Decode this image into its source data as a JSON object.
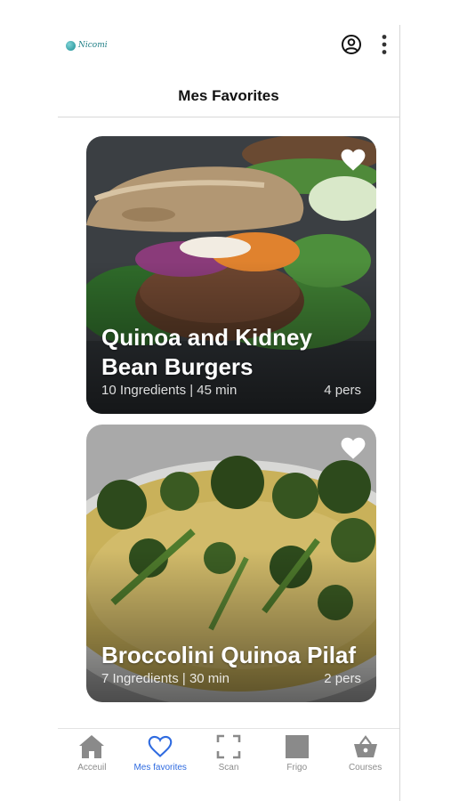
{
  "header": {
    "logo_text": "Nicomi",
    "page_title": "Mes Favorites",
    "profile_icon": "account-circle-icon",
    "menu_icon": "more-vertical-icon"
  },
  "recipes": [
    {
      "title": "Quinoa and Kidney Bean Burgers",
      "ingredients": "10 Ingredients | 45 min",
      "servings": "4 pers",
      "favorite": true
    },
    {
      "title": "Broccolini Quinoa Pilaf",
      "ingredients": "7 Ingredients | 30 min",
      "servings": "2 pers",
      "favorite": true
    }
  ],
  "nav": {
    "active_color": "#2f6be0",
    "inactive_color": "#8c8c8c",
    "items": [
      {
        "label": "Acceuil",
        "icon": "home-icon",
        "active": false
      },
      {
        "label": "Mes favorites",
        "icon": "heart-icon",
        "active": true
      },
      {
        "label": "Scan",
        "icon": "scan-icon",
        "active": false
      },
      {
        "label": "Frigo",
        "icon": "fridge-icon",
        "active": false
      },
      {
        "label": "Courses",
        "icon": "shopping-basket-icon",
        "active": false
      }
    ]
  }
}
